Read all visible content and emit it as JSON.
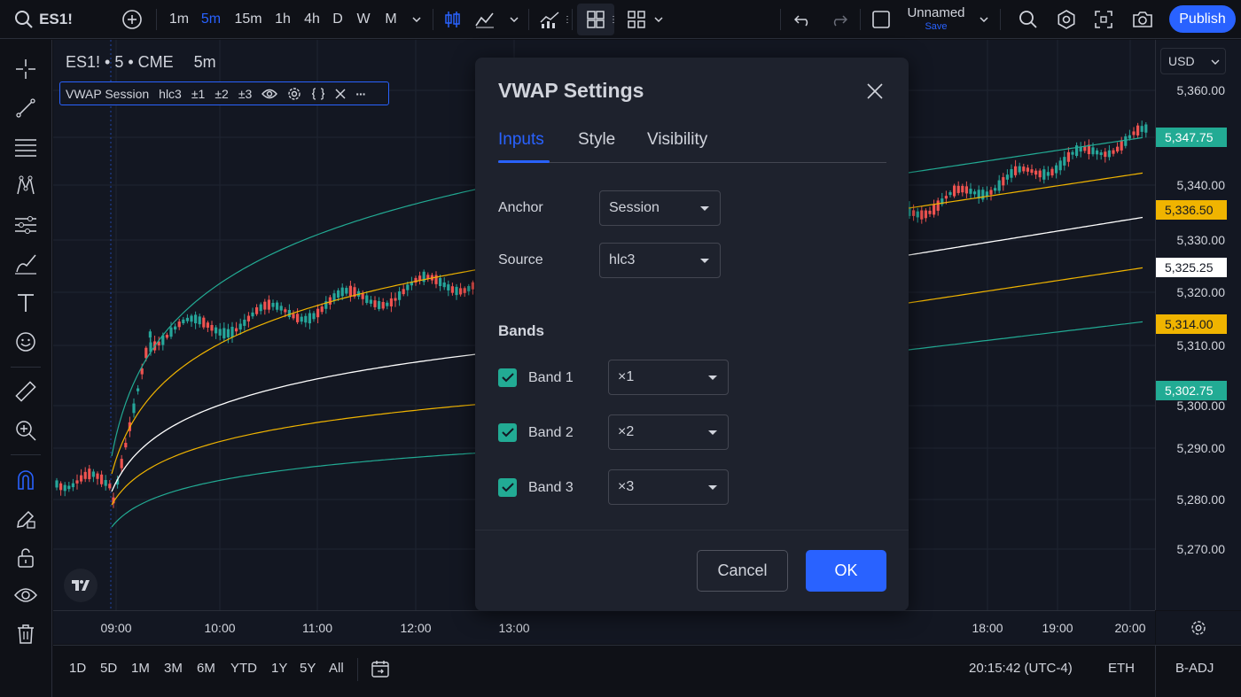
{
  "toolbar": {
    "symbol": "ES1!",
    "intervals": [
      "1m",
      "5m",
      "15m",
      "1h",
      "4h",
      "D",
      "W",
      "M"
    ],
    "active_interval": "5m",
    "layout_name": "Unnamed",
    "layout_save": "Save",
    "publish_label": "Publish"
  },
  "chart": {
    "symbol_line": "ES1! • 5 • CME",
    "interval_label": "5m",
    "indicator": {
      "name": "VWAP Session",
      "source": "hlc3",
      "bands": [
        "±1",
        "±2",
        "±3"
      ],
      "more": "···"
    },
    "currency": "USD",
    "price_labels": [
      "5,360.00",
      "5,340.00",
      "5,330.00",
      "5,320.00",
      "5,310.00",
      "5,300.00",
      "5,290.00",
      "5,280.00",
      "5,270.00"
    ],
    "price_tags": [
      {
        "label": "5,347.75",
        "bg": "#22ab94",
        "fg": "#ffffff"
      },
      {
        "label": "5,336.50",
        "bg": "#f0b400",
        "fg": "#131722"
      },
      {
        "label": "5,325.25",
        "bg": "#ffffff",
        "fg": "#131722"
      },
      {
        "label": "5,314.00",
        "bg": "#f0b400",
        "fg": "#131722"
      },
      {
        "label": "5,302.75",
        "bg": "#22ab94",
        "fg": "#ffffff"
      }
    ],
    "time_labels": [
      "09:00",
      "10:00",
      "11:00",
      "12:00",
      "13:00",
      "18:00",
      "19:00",
      "20:00"
    ],
    "colors": {
      "up": "#26a69a",
      "down": "#ef5350",
      "vwap": "#ffffff",
      "band_inner": "#f0b400",
      "band_outer": "#22ab94"
    }
  },
  "bottom": {
    "ranges": [
      "1D",
      "5D",
      "1M",
      "3M",
      "6M",
      "YTD",
      "1Y",
      "5Y",
      "All"
    ],
    "clock": "20:15:42 (UTC-4)",
    "session": "ETH",
    "adjust": "B-ADJ"
  },
  "dialog": {
    "title": "VWAP Settings",
    "tabs": [
      "Inputs",
      "Style",
      "Visibility"
    ],
    "active_tab": "Inputs",
    "anchor_label": "Anchor",
    "anchor_value": "Session",
    "source_label": "Source",
    "source_value": "hlc3",
    "bands_heading": "Bands",
    "bands": [
      {
        "label": "Band 1",
        "checked": true,
        "multiplier": "×1"
      },
      {
        "label": "Band 2",
        "checked": true,
        "multiplier": "×2"
      },
      {
        "label": "Band 3",
        "checked": true,
        "multiplier": "×3"
      }
    ],
    "cancel_label": "Cancel",
    "ok_label": "OK"
  }
}
